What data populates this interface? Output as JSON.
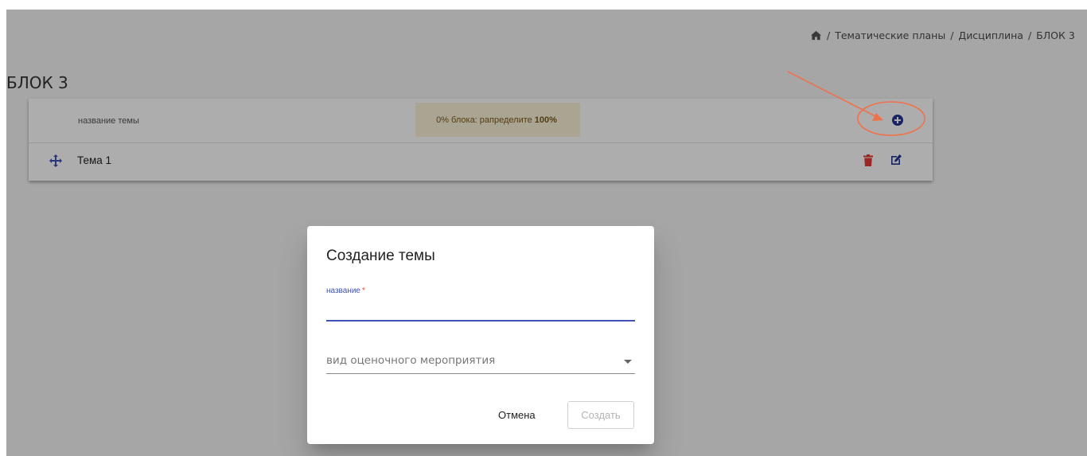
{
  "breadcrumb": {
    "home_icon": "home-icon",
    "sep": "/",
    "items": [
      "Тематические планы",
      "Дисциплина",
      "БЛОК 3"
    ]
  },
  "page": {
    "title": "БЛОК 3"
  },
  "table": {
    "column_label": "название темы",
    "allocation": {
      "pre": "0% блока: рапределите",
      "bold": "100%"
    },
    "add_icon": "plus-circle-icon",
    "rows": [
      {
        "title": "Тема 1",
        "move_icon": "move-icon",
        "delete_icon": "trash-icon",
        "edit_icon": "edit-icon"
      }
    ]
  },
  "dialog": {
    "title": "Создание темы",
    "name_field": {
      "label": "название",
      "required_mark": "*",
      "value": ""
    },
    "assessment_select": {
      "placeholder": "вид оценочного мероприятия"
    },
    "cancel_label": "Отмена",
    "create_label": "Создать"
  },
  "colors": {
    "accent": "#3f51b5",
    "danger": "#e53935",
    "annotation": "#f0714a",
    "badge_bg": "#fbf2d7"
  }
}
